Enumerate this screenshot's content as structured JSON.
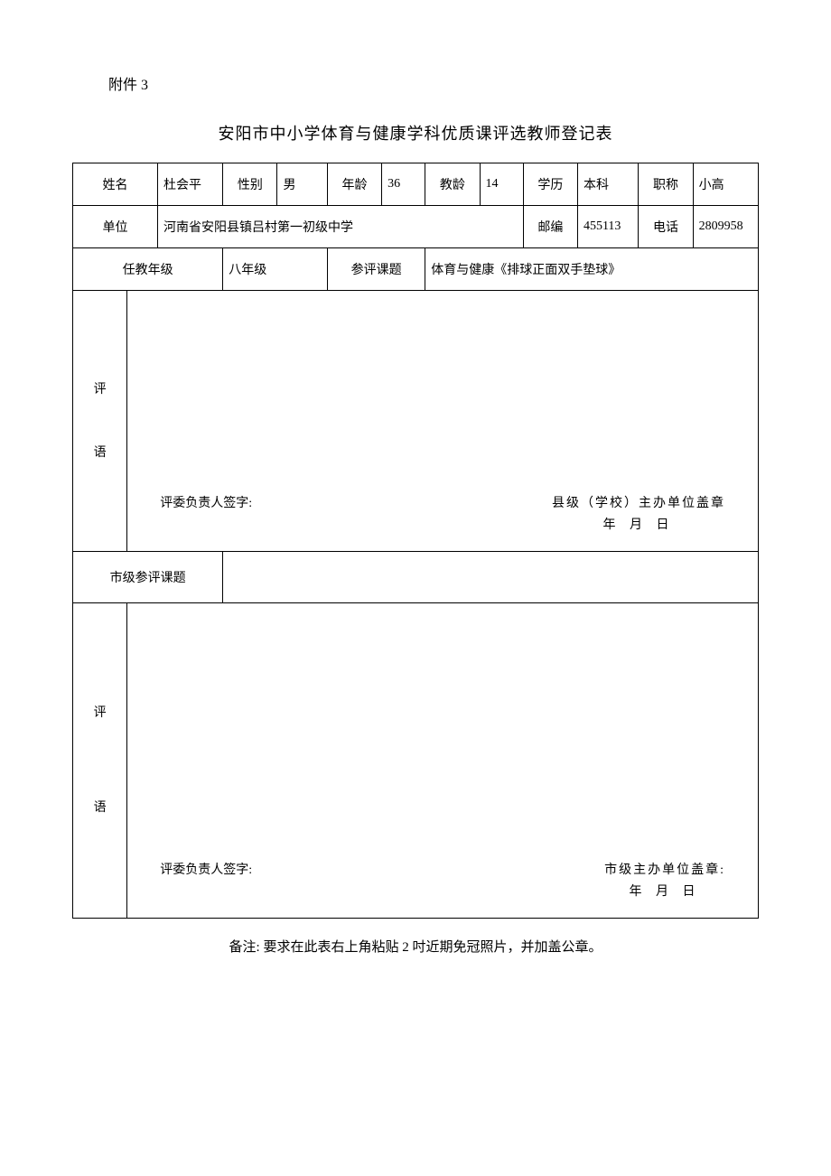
{
  "attachment": "附件 3",
  "title": "安阳市中小学体育与健康学科优质课评选教师登记表",
  "row1": {
    "name_label": "姓名",
    "name": "杜会平",
    "gender_label": "性别",
    "gender": "男",
    "age_label": "年龄",
    "age": "36",
    "teach_age_label": "教龄",
    "teach_age": "14",
    "edu_label": "学历",
    "edu": "本科",
    "title_label": "职称",
    "title_val": "小高"
  },
  "row2": {
    "unit_label": "单位",
    "unit": "河南省安阳县镇吕村第一初级中学",
    "postcode_label": "邮编",
    "postcode": "455113",
    "phone_label": "电话",
    "phone": "2809958"
  },
  "row3": {
    "grade_label": "任教年级",
    "grade": "八年级",
    "topic_label": "参评课题",
    "topic": "体育与健康《排球正面双手垫球》"
  },
  "comment1": {
    "label": "评\n语",
    "sign_label": "评委负责人签字:",
    "stamp_label": "县级（学校）主办单位盖章",
    "date": "年    月    日"
  },
  "city_topic_label": "市级参评课题",
  "comment2": {
    "label": "评\n\n语",
    "sign_label": "评委负责人签字:",
    "stamp_label": "市级主办单位盖章:",
    "date": "年  月  日"
  },
  "note": "备注:  要求在此表右上角粘贴 2 吋近期免冠照片，并加盖公章。"
}
